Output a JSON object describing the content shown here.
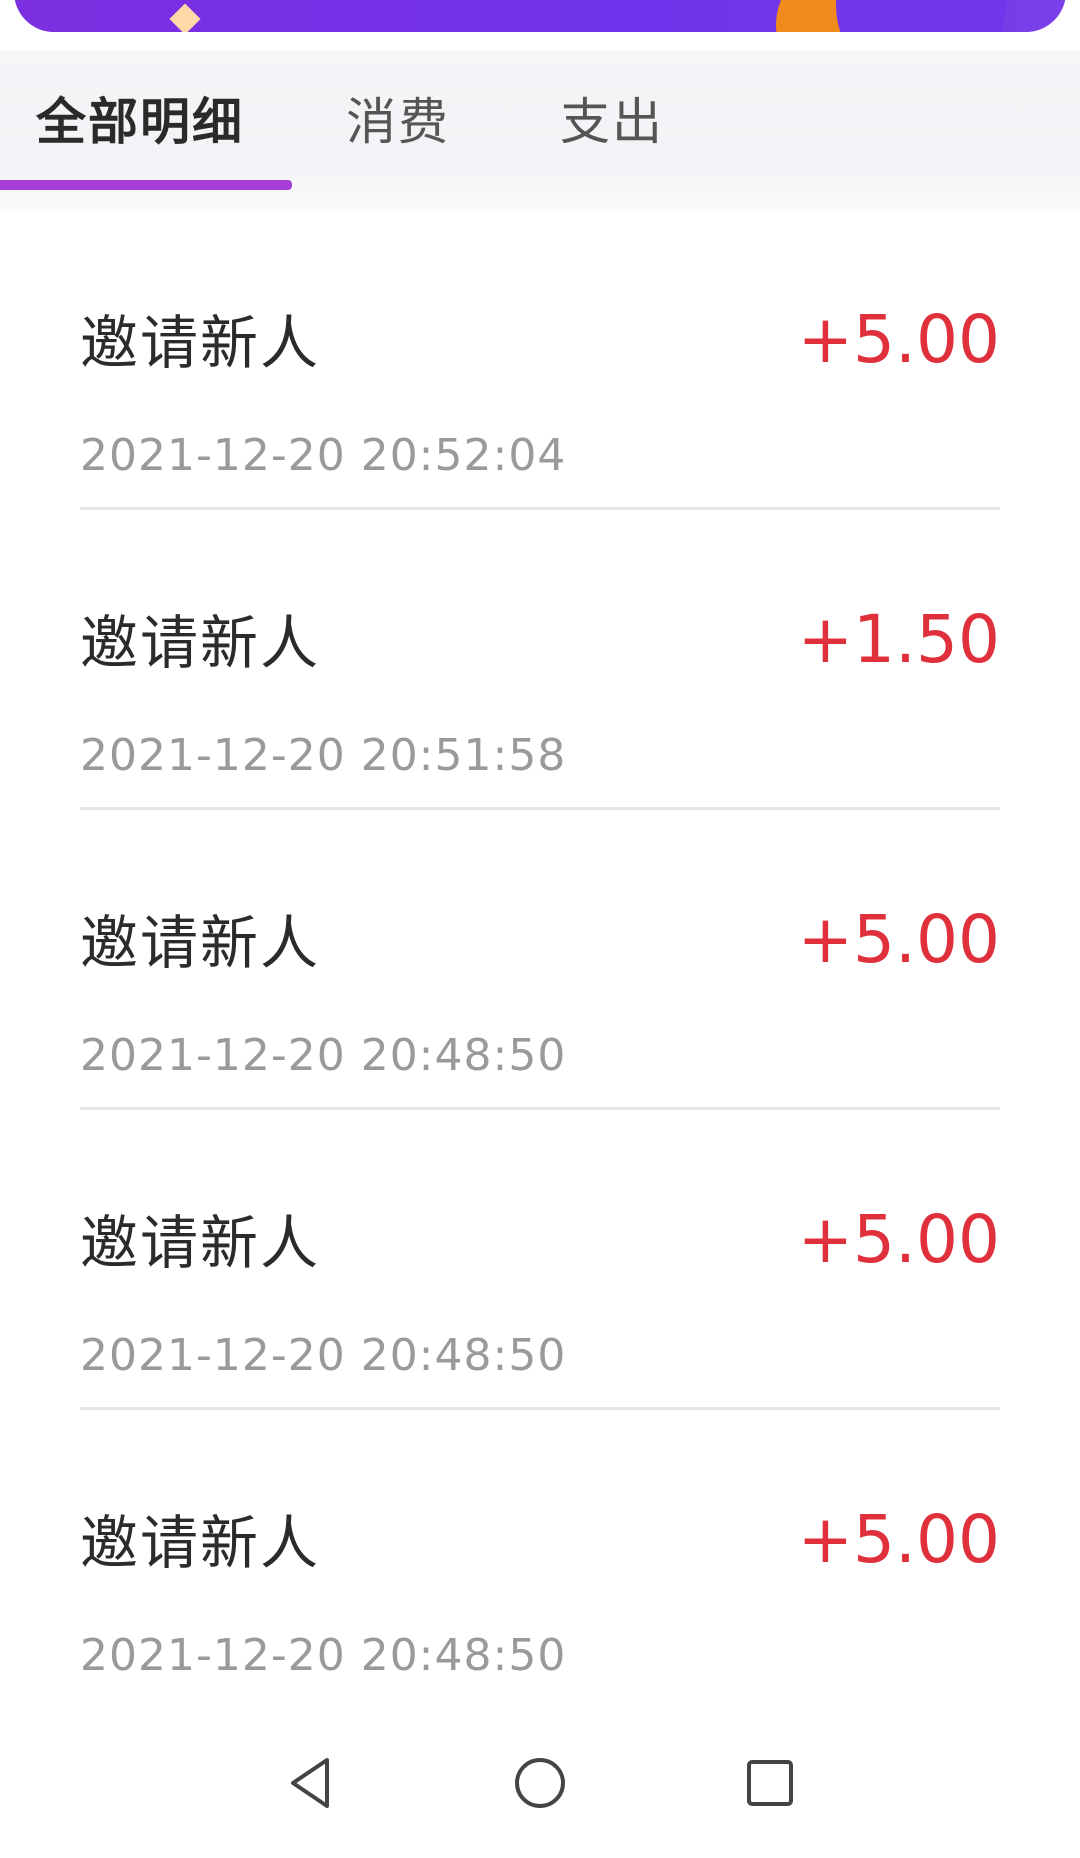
{
  "tabs": [
    {
      "label": "全部明细",
      "active": true
    },
    {
      "label": "消费",
      "active": false
    },
    {
      "label": "支出",
      "active": false
    }
  ],
  "records": [
    {
      "title": "邀请新人",
      "amount": "+5.00",
      "time": "2021-12-20 20:52:04"
    },
    {
      "title": "邀请新人",
      "amount": "+1.50",
      "time": "2021-12-20 20:51:58"
    },
    {
      "title": "邀请新人",
      "amount": "+5.00",
      "time": "2021-12-20 20:48:50"
    },
    {
      "title": "邀请新人",
      "amount": "+5.00",
      "time": "2021-12-20 20:48:50"
    },
    {
      "title": "邀请新人",
      "amount": "+5.00",
      "time": "2021-12-20 20:48:50"
    }
  ],
  "colors": {
    "accent": "#a63fd8",
    "banner": "#7b2fe0",
    "amount_positive": "#e0303c"
  },
  "navbar": {
    "icons": [
      "back-triangle-icon",
      "home-circle-icon",
      "recent-square-icon"
    ]
  }
}
